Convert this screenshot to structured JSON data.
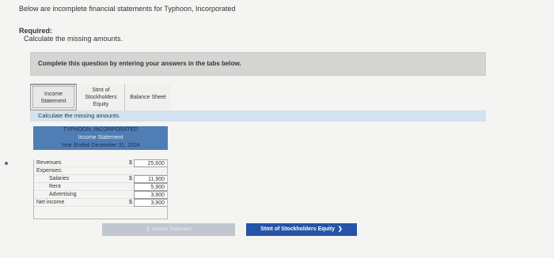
{
  "intro": "Below are incomplete financial statements for Typhoon, Incorporated",
  "required": {
    "heading": "Required:",
    "text": "Calculate the missing amounts."
  },
  "banner": "Complete this question by entering your answers in the tabs below.",
  "tabs": [
    {
      "l1": "Income",
      "l2": "Statement"
    },
    {
      "l1": "Stmt of",
      "l2": "Stockholders",
      "l3": "Equity"
    },
    {
      "l1": "Balance Sheet"
    }
  ],
  "panel_instruction": "Calculate the missing amounts.",
  "statement": {
    "company": "TYPHOON, INCORPORATED",
    "title": "Income Statement",
    "period": "Year Ended December 31, 2024",
    "rows": [
      {
        "label": "Revenues",
        "currency": "$",
        "value": "25,600"
      },
      {
        "label": "Expenses:"
      },
      {
        "label": "Salaries",
        "currency": "$",
        "value": "11,900"
      },
      {
        "label": "Rent",
        "value": "5,900"
      },
      {
        "label": "Advertising",
        "value": "3,900"
      },
      {
        "label": "Net income",
        "currency": "$",
        "value": "3,900"
      }
    ]
  },
  "nav": {
    "prev": "Income Statement",
    "next": "Stmt of Stockholders Equity"
  },
  "colors": {
    "header_blue": "#4f7eb5",
    "panel_blue": "#d3e2ef",
    "next_btn": "#2554a8"
  }
}
